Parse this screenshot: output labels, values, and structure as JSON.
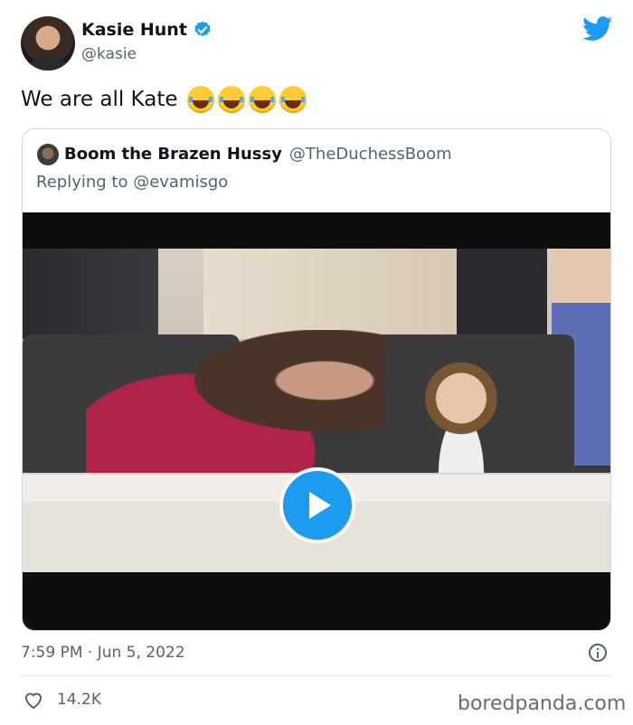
{
  "author": {
    "name": "Kasie Hunt",
    "handle": "@kasie"
  },
  "tweet": {
    "text": "We are all Kate",
    "emojis": [
      "😂",
      "😂",
      "😂",
      "😂"
    ]
  },
  "quoted_tweet": {
    "name": "Boom the Brazen Hussy",
    "handle": "@TheDuchessBoom",
    "replying_to": "Replying to @evamisgo"
  },
  "meta": {
    "timestamp": "7:59 PM · Jun 5, 2022"
  },
  "engagement": {
    "likes": "14.2K"
  },
  "watermark": "boredpanda.com",
  "colors": {
    "accent": "#1d9bf0",
    "muted": "#536471",
    "border": "#cfd9de"
  },
  "icons": [
    "verified-badge-icon",
    "twitter-bird-icon",
    "play-icon",
    "info-icon",
    "heart-icon"
  ]
}
